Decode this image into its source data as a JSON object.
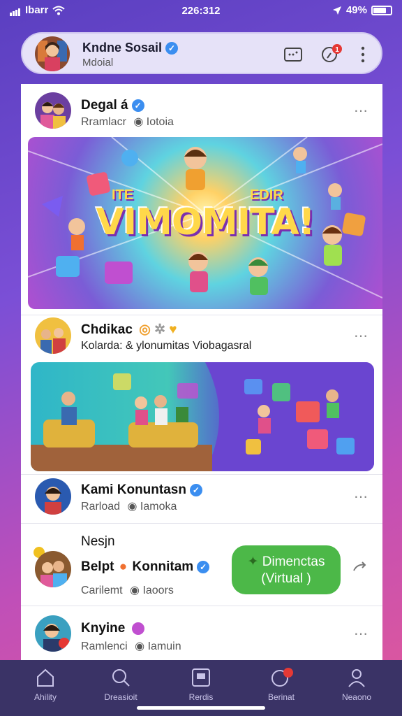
{
  "status_bar": {
    "carrier": "Ibarr",
    "time": "226:312",
    "battery": "49%"
  },
  "header": {
    "title": "Kndne Sosail",
    "subtitle": "Mdoial"
  },
  "posts": [
    {
      "name": "Degal á",
      "sub": "Rramlacr",
      "location": "Iotoia",
      "banner_text": "VIMOMITA!",
      "banner_left": "ITE",
      "banner_right": "EDIR"
    },
    {
      "name": "Chdikac",
      "sub": "Kolarda: & ylonumitas Viobagasral"
    },
    {
      "name": "Kami Konuntasn",
      "sub": "Rarload",
      "location": "Iamoka"
    },
    {
      "label": "Nesjn",
      "name": "Belpt",
      "name2": "Konnitam",
      "sub": "Carilemt",
      "location": "Iaoors",
      "cta": "Dimenctas (Virtual )"
    },
    {
      "name": "Knyine",
      "sub": "Ramlenci",
      "location": "Iamuin"
    }
  ],
  "nav": [
    {
      "label": "Ahility",
      "icon": "home-icon"
    },
    {
      "label": "Dreasioit",
      "icon": "search-icon"
    },
    {
      "label": "Rerdis",
      "icon": "feed-icon"
    },
    {
      "label": "Berinat",
      "icon": "notification-icon",
      "badge": ""
    },
    {
      "label": "Neaono",
      "icon": "profile-icon"
    }
  ],
  "colors": {
    "accent": "#3b8ef0",
    "cta": "#4cb848",
    "nav_bg": "#3a3366",
    "badge": "#e53935"
  }
}
